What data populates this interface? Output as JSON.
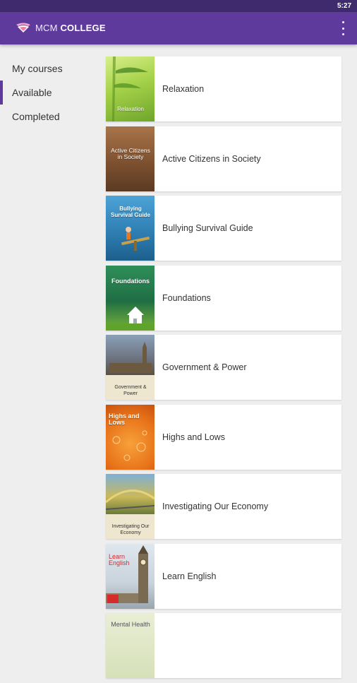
{
  "status_bar": {
    "time": "5:27"
  },
  "app_bar": {
    "title_part1": "MCM",
    "title_part2": "COLLEGE"
  },
  "sidebar": {
    "items": [
      {
        "label": "My courses",
        "active": false
      },
      {
        "label": "Available",
        "active": true
      },
      {
        "label": "Completed",
        "active": false
      }
    ]
  },
  "courses": [
    {
      "title": "Relaxation",
      "thumb_text": "Relaxation"
    },
    {
      "title": "Active Citizens in Society",
      "thumb_text": "Active Citizens in Society"
    },
    {
      "title": "Bullying Survival Guide",
      "thumb_text": "Bullying Survival Guide"
    },
    {
      "title": "Foundations",
      "thumb_text": "Foundations"
    },
    {
      "title": "Government & Power",
      "thumb_text": "Government & Power"
    },
    {
      "title": "Highs and Lows",
      "thumb_text": "Highs and Lows"
    },
    {
      "title": "Investigating Our Economy",
      "thumb_text": "Investigating Our Economy"
    },
    {
      "title": "Learn English",
      "thumb_text": "Learn English"
    },
    {
      "title": "",
      "thumb_text": "Mental Health"
    }
  ],
  "colors": {
    "accent": "#5e3a9c",
    "status_bar": "#3f2a6e",
    "background": "#eeeeee"
  }
}
